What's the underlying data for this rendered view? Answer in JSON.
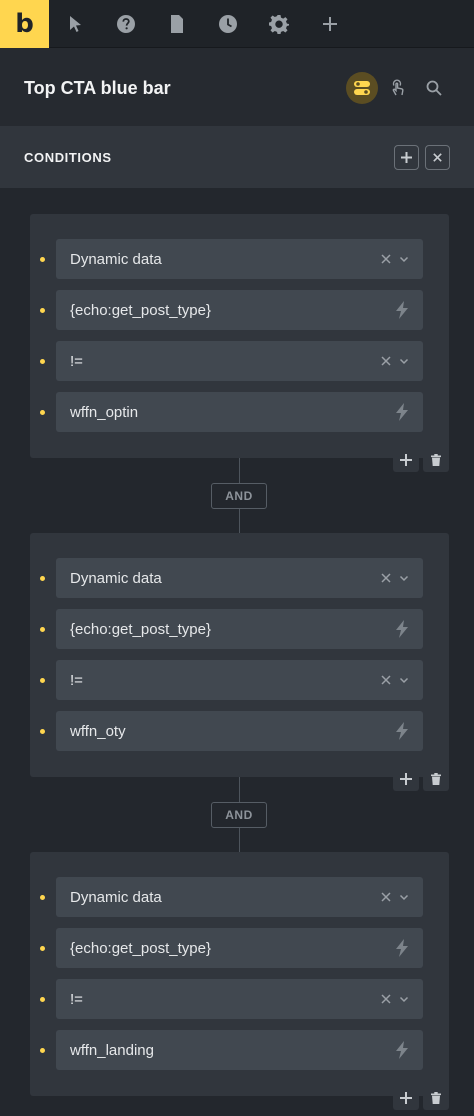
{
  "toolbar": {
    "logo": "b",
    "tools": [
      {
        "name": "pointer-icon"
      },
      {
        "name": "help-icon"
      },
      {
        "name": "page-icon"
      },
      {
        "name": "history-icon"
      },
      {
        "name": "settings-icon"
      },
      {
        "name": "add-icon"
      }
    ]
  },
  "header": {
    "title": "Top CTA blue bar"
  },
  "conditions": {
    "title": "CONDITIONS",
    "connector_label": "AND",
    "groups": [
      {
        "rows": [
          {
            "value": "Dynamic data",
            "kind": "select"
          },
          {
            "value": "{echo:get_post_type}",
            "kind": "dynamic"
          },
          {
            "value": "!=",
            "kind": "select"
          },
          {
            "value": "wffn_optin",
            "kind": "dynamic"
          }
        ]
      },
      {
        "rows": [
          {
            "value": "Dynamic data",
            "kind": "select"
          },
          {
            "value": "{echo:get_post_type}",
            "kind": "dynamic"
          },
          {
            "value": "!=",
            "kind": "select"
          },
          {
            "value": "wffn_oty",
            "kind": "dynamic"
          }
        ]
      },
      {
        "rows": [
          {
            "value": "Dynamic data",
            "kind": "select"
          },
          {
            "value": "{echo:get_post_type}",
            "kind": "dynamic"
          },
          {
            "value": "!=",
            "kind": "select"
          },
          {
            "value": "wffn_landing",
            "kind": "dynamic"
          }
        ]
      }
    ]
  },
  "colors": {
    "accent": "#ffd64f",
    "background": "#23272d",
    "panel": "#31363d",
    "field": "#414850"
  }
}
